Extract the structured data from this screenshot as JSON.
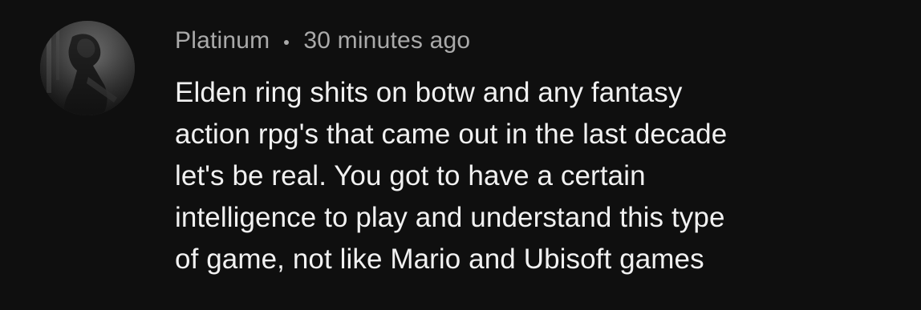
{
  "comment": {
    "author": "Platinum",
    "separator": "•",
    "timestamp": "30 minutes ago",
    "avatar_icon": "user-avatar-photo",
    "text_lines": [
      "Elden ring shits on botw and any fantasy",
      "action rpg's that came out in the last decade",
      "let's be real. You got to have a certain",
      "intelligence to play and understand this type",
      "of game, not like Mario and Ubisoft games"
    ]
  },
  "colors": {
    "background": "#0f0f0f",
    "meta_text": "#aaaaaa",
    "body_text": "#f1f1f1"
  }
}
